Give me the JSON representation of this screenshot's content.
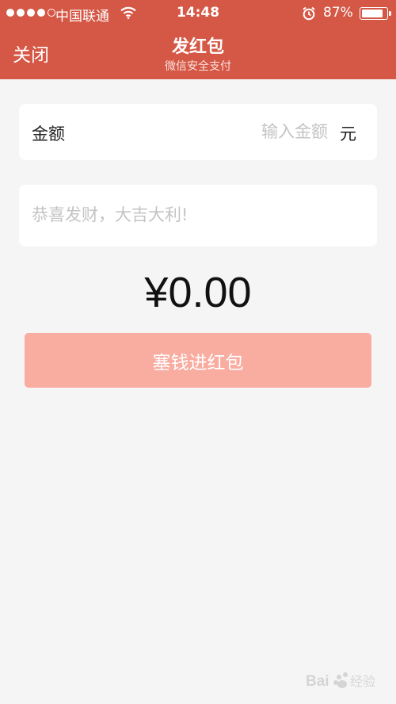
{
  "status_bar": {
    "carrier": "中国联通",
    "time": "14:48",
    "battery": "87%",
    "battery_level": 0.87
  },
  "header": {
    "close_label": "关闭",
    "title": "发红包",
    "subtitle": "微信安全支付"
  },
  "amount": {
    "label": "金额",
    "placeholder": "输入金额",
    "unit": "元"
  },
  "message": {
    "placeholder": "恭喜发财，大吉大利!"
  },
  "total": "¥0.00",
  "submit_label": "塞钱进红包",
  "colors": {
    "header": "#d55745",
    "button_disabled": "#f9aca0",
    "background": "#f5f5f5"
  },
  "watermark": "Baidu 经验"
}
